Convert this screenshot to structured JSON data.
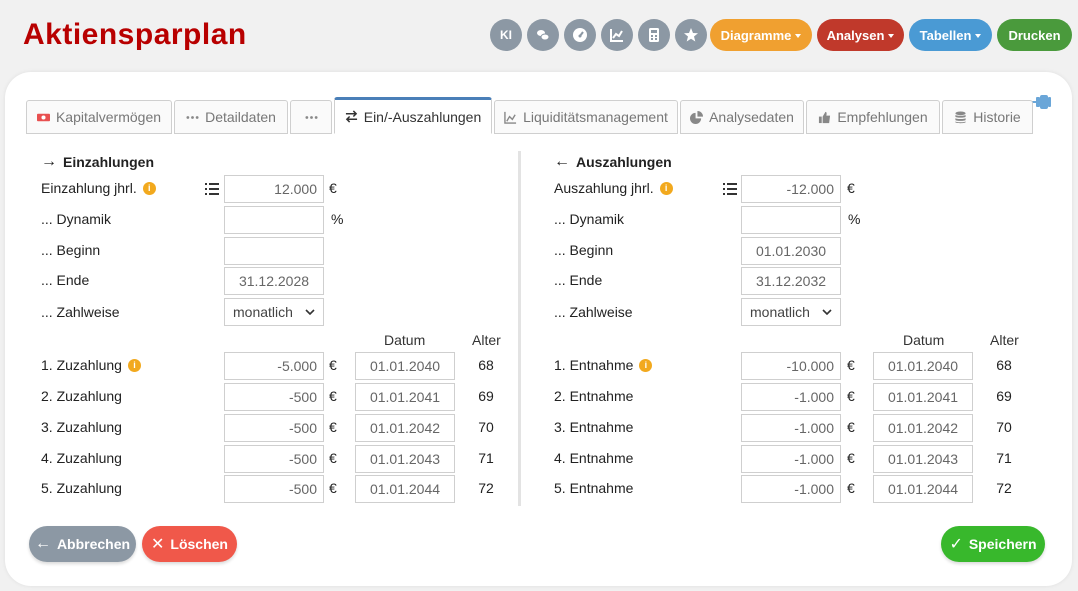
{
  "app": {
    "title": "Aktiensparplan"
  },
  "topbar": {
    "icons": [
      {
        "name": "ki",
        "label": "KI"
      },
      {
        "name": "coins-icon"
      },
      {
        "name": "gauge-icon"
      },
      {
        "name": "chart-line-icon"
      },
      {
        "name": "calculator-icon"
      },
      {
        "name": "star-icon"
      }
    ],
    "diagramme": "Diagramme",
    "analysen": "Analysen",
    "tabellen": "Tabellen",
    "drucken": "Drucken"
  },
  "tabs": [
    {
      "label": "Kapitalvermögen",
      "icon": "money-icon"
    },
    {
      "label": "Detaildaten",
      "icon": "dots-icon"
    },
    {
      "label": "",
      "icon": "dots-icon"
    },
    {
      "label": "Ein/-Auszahlungen",
      "icon": "exchange-icon",
      "active": true
    },
    {
      "label": "Liquiditätsmanagement",
      "icon": "area-chart-icon"
    },
    {
      "label": "Analysedaten",
      "icon": "pie-chart-icon"
    },
    {
      "label": "Empfehlungen",
      "icon": "thumbs-up-icon"
    },
    {
      "label": "Historie",
      "icon": "database-icon"
    }
  ],
  "einzahlungen": {
    "title": "Einzahlungen",
    "jahr_label": "Einzahlung jhrl.",
    "jahr_value": "12.000",
    "dynamik_label": "... Dynamik",
    "dynamik_value": "",
    "beginn_label": "... Beginn",
    "beginn_value": "",
    "ende_label": "... Ende",
    "ende_value": "31.12.2028",
    "zahlweise_label": "... Zahlweise",
    "zahlweise_value": "monatlich",
    "currency": "€",
    "percent": "%",
    "rows": [
      {
        "label": "1. Zuzahlung",
        "amount": "-5.000",
        "date": "01.01.2040",
        "age": "68",
        "info": true
      },
      {
        "label": "2. Zuzahlung",
        "amount": "-500",
        "date": "01.01.2041",
        "age": "69"
      },
      {
        "label": "3. Zuzahlung",
        "amount": "-500",
        "date": "01.01.2042",
        "age": "70"
      },
      {
        "label": "4. Zuzahlung",
        "amount": "-500",
        "date": "01.01.2043",
        "age": "71"
      },
      {
        "label": "5. Zuzahlung",
        "amount": "-500",
        "date": "01.01.2044",
        "age": "72"
      }
    ]
  },
  "auszahlungen": {
    "title": "Auszahlungen",
    "jahr_label": "Auszahlung jhrl.",
    "jahr_value": "-12.000",
    "dynamik_label": "... Dynamik",
    "dynamik_value": "",
    "beginn_label": "... Beginn",
    "beginn_value": "01.01.2030",
    "ende_label": "... Ende",
    "ende_value": "31.12.2032",
    "zahlweise_label": "... Zahlweise",
    "zahlweise_value": "monatlich",
    "currency": "€",
    "percent": "%",
    "rows": [
      {
        "label": "1. Entnahme",
        "amount": "-10.000",
        "date": "01.01.2040",
        "age": "68",
        "info": true
      },
      {
        "label": "2. Entnahme",
        "amount": "-1.000",
        "date": "01.01.2041",
        "age": "69"
      },
      {
        "label": "3. Entnahme",
        "amount": "-1.000",
        "date": "01.01.2042",
        "age": "70"
      },
      {
        "label": "4. Entnahme",
        "amount": "-1.000",
        "date": "01.01.2043",
        "age": "71"
      },
      {
        "label": "5. Entnahme",
        "amount": "-1.000",
        "date": "01.01.2044",
        "age": "72"
      }
    ]
  },
  "columns": {
    "datum": "Datum",
    "alter": "Alter"
  },
  "footer": {
    "abbrechen": "Abbrechen",
    "loeschen": "Löschen",
    "speichern": "Speichern"
  },
  "colors": {
    "title": "#b80000",
    "diagramme": "#f0a030",
    "analysen": "#c0392b",
    "tabellen": "#4a9ad4",
    "drucken": "#4a9a3c",
    "abbrechen": "#8c98a4",
    "loeschen": "#f0584a",
    "speichern": "#38b82c"
  }
}
